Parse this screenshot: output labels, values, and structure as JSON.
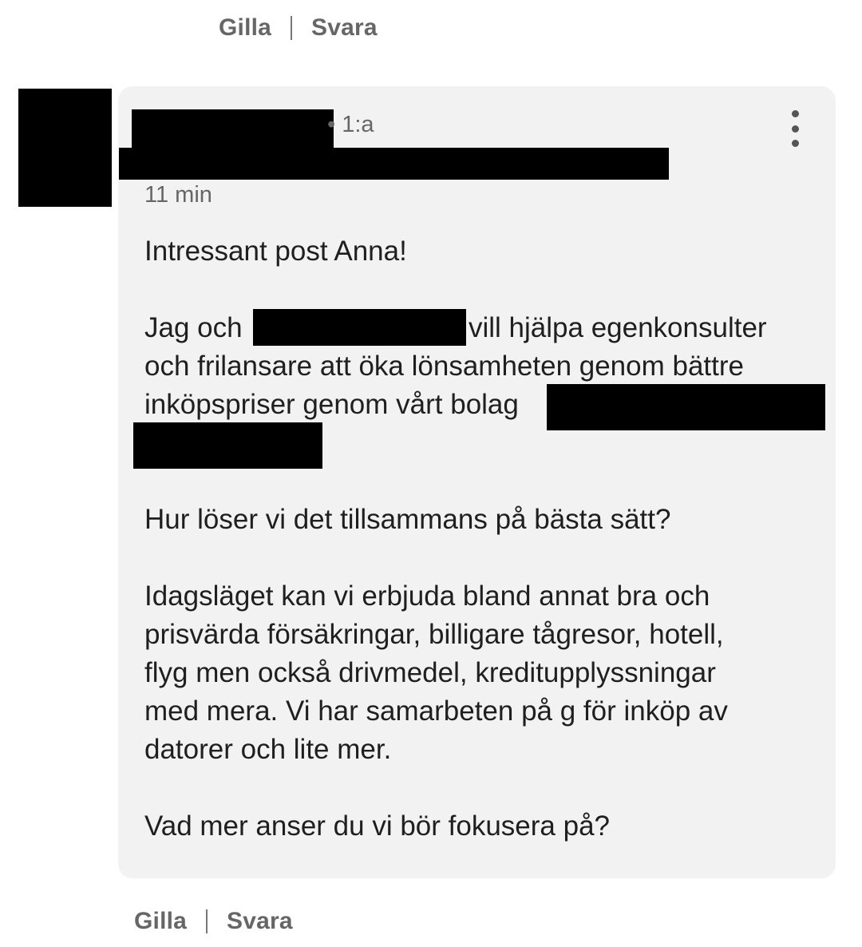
{
  "previous_comment_actions": {
    "like_label": "Gilla",
    "reply_label": "Svara"
  },
  "comment": {
    "degree": "• 1:a",
    "time": "11 min",
    "paragraphs": {
      "p1": "Intressant post Anna!",
      "p2_line1_start": "Jag och",
      "p2_line1_end": "vill hjälpa egenkonsulter",
      "p2_line2": "och frilansare att öka lönsamheten genom bättre",
      "p2_line3": "inköpspriser genom vårt bolag",
      "p3": "Hur löser vi det tillsammans på bästa sätt?",
      "p4_line1": "Idagsläget kan vi erbjuda bland annat bra och",
      "p4_line2": "prisvärda försäkringar, billigare tågresor, hotell,",
      "p4_line3": "flyg men också drivmedel, kreditupplyssningar",
      "p4_line4": "med mera. Vi har samarbeten på g för inköp av",
      "p4_line5": "datorer och lite mer.",
      "p5": "Vad mer anser du vi bör fokusera på?"
    }
  },
  "comment_actions": {
    "like_label": "Gilla",
    "reply_label": "Svara"
  },
  "icons": {
    "more": "more-vertical-icon"
  }
}
